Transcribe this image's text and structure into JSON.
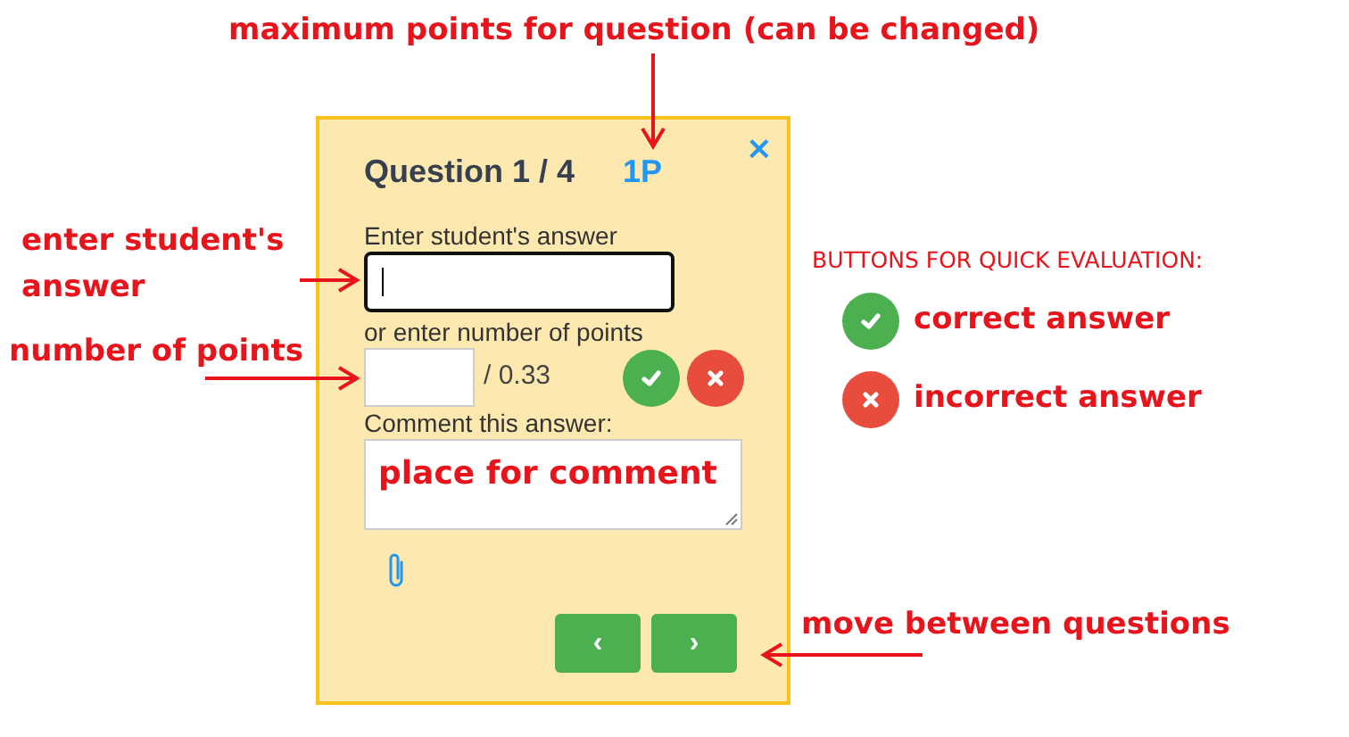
{
  "question": {
    "title": "Question 1 / 4",
    "max_points": "1P",
    "close": "×"
  },
  "answer_field": {
    "label": "Enter student's answer",
    "focused": true
  },
  "points_field": {
    "label": "or enter number of points",
    "total": "/ 0.33"
  },
  "comment_field": {
    "label": "Comment this answer:"
  },
  "annotations": [
    {
      "text": "maximum points for question (can be changed)"
    },
    {
      "text": "enter student's answer"
    },
    {
      "text": "number of points"
    },
    {
      "text": "place for comment"
    },
    {
      "text": "move between questions"
    }
  ],
  "legend": {
    "title": "BUTTONS FOR QUICK EVALUATION:",
    "items": [
      {
        "kind": "correct",
        "text": "correct answer"
      },
      {
        "kind": "incorrect",
        "text": "incorrect answer"
      }
    ]
  },
  "nav": [
    "‹",
    "›"
  ]
}
